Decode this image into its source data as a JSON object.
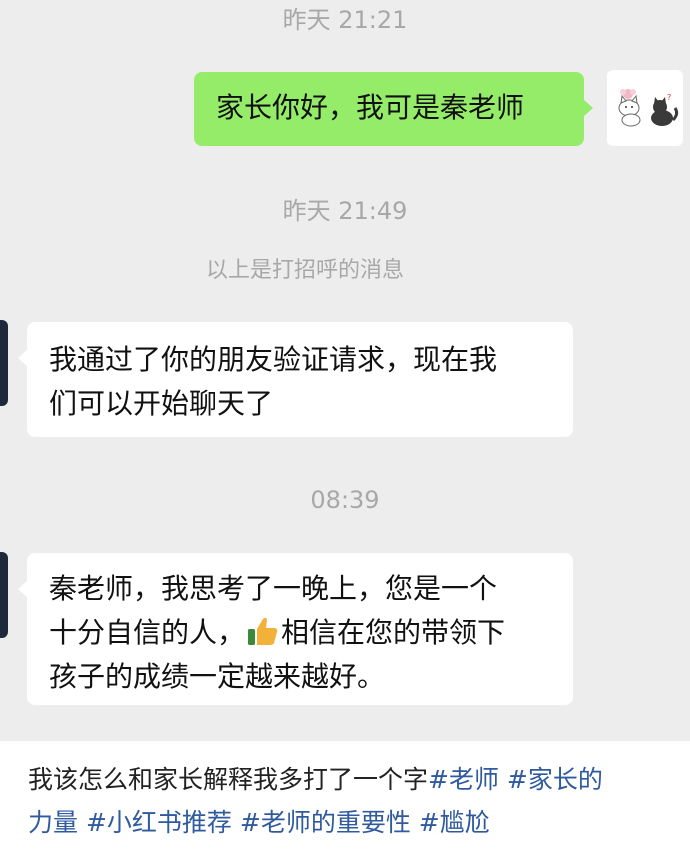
{
  "chat": {
    "timestamps": {
      "t1": "昨天 21:21",
      "t2": "昨天 21:49",
      "t3": "08:39"
    },
    "system_note": "以上是打招呼的消息",
    "outgoing_message": "家长你好，我可是秦老师",
    "incoming_message_1": {
      "line1": "我通过了你的朋友验证请求，现在我",
      "line2": "们可以开始聊天了"
    },
    "incoming_message_2": {
      "line1": "秦老师，我思考了一晚上，您是一个",
      "line2a": "十分自信的人，",
      "line2b": "相信在您的带领下",
      "line3": "孩子的成绩一定越来越好。"
    },
    "emoji_icon": "thumbs-up-icon",
    "bubble_out_color": "#95ec69",
    "bubble_in_color": "#ffffff",
    "chat_background": "#ededed"
  },
  "caption": {
    "line1_text": "我该怎么和家长解释我多打了一个字",
    "tag_teacher": "#老师",
    "tag_parent": "#家长的",
    "tag_parent_cont": "力量",
    "tag_xhs": "#小红书推荐",
    "tag_importance": "#老师的重要性",
    "tag_awkward": "#尴尬",
    "tag_color": "#2f5a9e"
  }
}
